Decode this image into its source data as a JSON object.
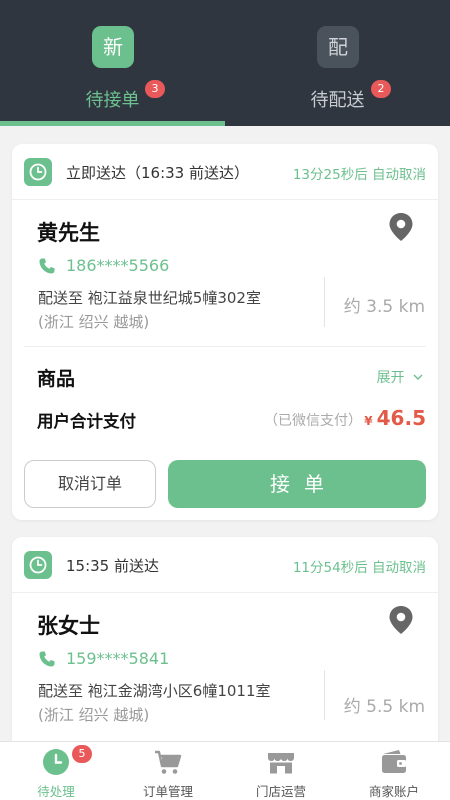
{
  "header": {
    "tabs": [
      {
        "icon_char": "新",
        "label": "待接单",
        "badge": "3",
        "active": true
      },
      {
        "icon_char": "配",
        "label": "待配送",
        "badge": "2",
        "active": false
      }
    ]
  },
  "orders": [
    {
      "delivery_time": "立即送达（16:33 前送达）",
      "countdown": "13分25秒后 自动取消",
      "customer_name": "黄先生",
      "phone": "186****5566",
      "address": "配送至  袍江益泉世纪城5幢302室",
      "address_region": "(浙江 绍兴 越城)",
      "distance": "约 3.5 km",
      "goods_title": "商品",
      "expand_label": "展开",
      "pay_label": "用户合计支付",
      "pay_note": "（已微信支付）",
      "currency": "¥",
      "amount": "46.5",
      "cancel_label": "取消订单",
      "accept_label": "接单"
    },
    {
      "delivery_time": "15:35 前送达",
      "countdown": "11分54秒后 自动取消",
      "customer_name": "张女士",
      "phone": "159****5841",
      "address": "配送至  袍江金湖湾小区6幢1011室",
      "address_region": "(浙江 绍兴 越城)",
      "distance": "约 5.5 km"
    }
  ],
  "bottom_nav": [
    {
      "label": "待处理",
      "icon": "clock-icon",
      "badge": "5",
      "active": true
    },
    {
      "label": "订单管理",
      "icon": "cart-icon",
      "active": false
    },
    {
      "label": "门店运营",
      "icon": "store-icon",
      "active": false
    },
    {
      "label": "商家账户",
      "icon": "wallet-icon",
      "active": false
    }
  ],
  "colors": {
    "header_bg": "#2f3640",
    "accent": "#6cc08e",
    "badge": "#e9595a",
    "price": "#e25a48"
  }
}
